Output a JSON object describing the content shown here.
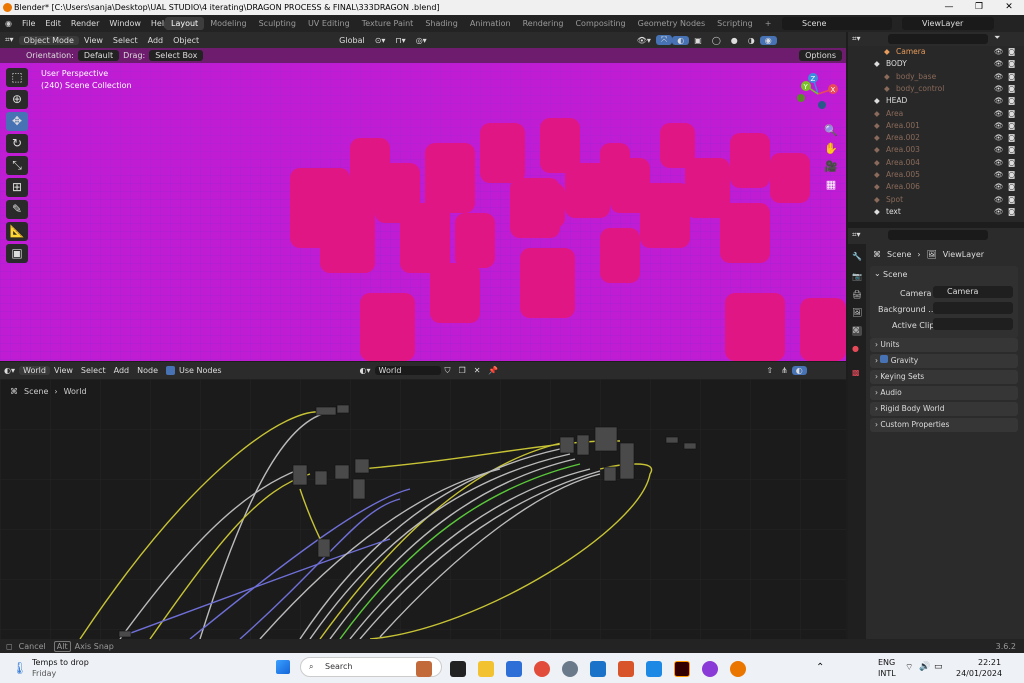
{
  "window": {
    "title": "Blender* [C:\\Users\\sanja\\Desktop\\UAL STUDIO\\4 iterating\\DRAGON PROCESS & FINAL\\333DRAGON .blend]"
  },
  "menu": [
    "File",
    "Edit",
    "Render",
    "Window",
    "Help"
  ],
  "workspaces": [
    "Layout",
    "Modeling",
    "Sculpting",
    "UV Editing",
    "Texture Paint",
    "Shading",
    "Animation",
    "Rendering",
    "Compositing",
    "Geometry Nodes",
    "Scripting"
  ],
  "top_right": {
    "scene": "Scene",
    "view_layer": "ViewLayer"
  },
  "viewport_header": {
    "mode": "Object Mode",
    "items": [
      "View",
      "Select",
      "Add",
      "Object"
    ],
    "transform": "Global"
  },
  "tool_settings": {
    "orientation_label": "Orientation:",
    "orientation_value": "Default",
    "drag_label": "Drag:",
    "drag_value": "Select Box",
    "options": "Options"
  },
  "viewport": {
    "perspective": "User Perspective",
    "collection": "(240) Scene Collection"
  },
  "gizmo": {
    "x": "X",
    "y": "Y",
    "z": "Z"
  },
  "node_header": {
    "type": "World",
    "items": [
      "View",
      "Select",
      "Add",
      "Node"
    ],
    "use_nodes": "Use Nodes",
    "world_name": "World"
  },
  "breadcrumb": {
    "a": "Scene",
    "b": "World"
  },
  "status": {
    "cancel": "Cancel",
    "alt": "Alt",
    "axis_snap": "Axis Snap",
    "version": "3.6.2"
  },
  "outliner": [
    {
      "name": "Camera",
      "indent": 1,
      "color": "#e89b5a"
    },
    {
      "name": "BODY",
      "indent": 0,
      "color": "#dddddd"
    },
    {
      "name": "body_base",
      "indent": 1,
      "color": "#8a6a5a"
    },
    {
      "name": "body_control",
      "indent": 1,
      "color": "#8a6a5a"
    },
    {
      "name": "HEAD",
      "indent": 0,
      "color": "#dddddd"
    },
    {
      "name": "Area",
      "indent": 0,
      "color": "#8a6a5a"
    },
    {
      "name": "Area.001",
      "indent": 0,
      "color": "#8a6a5a"
    },
    {
      "name": "Area.002",
      "indent": 0,
      "color": "#8a6a5a"
    },
    {
      "name": "Area.003",
      "indent": 0,
      "color": "#8a6a5a"
    },
    {
      "name": "Area.004",
      "indent": 0,
      "color": "#8a6a5a"
    },
    {
      "name": "Area.005",
      "indent": 0,
      "color": "#8a6a5a"
    },
    {
      "name": "Area.006",
      "indent": 0,
      "color": "#8a6a5a"
    },
    {
      "name": "Spot",
      "indent": 0,
      "color": "#8a6a5a"
    },
    {
      "name": "text",
      "indent": 0,
      "color": "#dddddd"
    }
  ],
  "properties": {
    "crumb_a": "Scene",
    "crumb_b": "ViewLayer",
    "section": "Scene",
    "camera_label": "Camera",
    "camera_value": "Camera",
    "background_label": "Background ...",
    "active_clip_label": "Active Clip",
    "panels": [
      "Units",
      "Gravity",
      "Keying Sets",
      "Audio",
      "Rigid Body World",
      "Custom Properties"
    ]
  },
  "taskbar": {
    "weather_title": "Temps to drop",
    "weather_day": "Friday",
    "search": "Search",
    "lang1": "ENG",
    "lang2": "INTL",
    "time": "22:21",
    "date": "24/01/2024"
  }
}
